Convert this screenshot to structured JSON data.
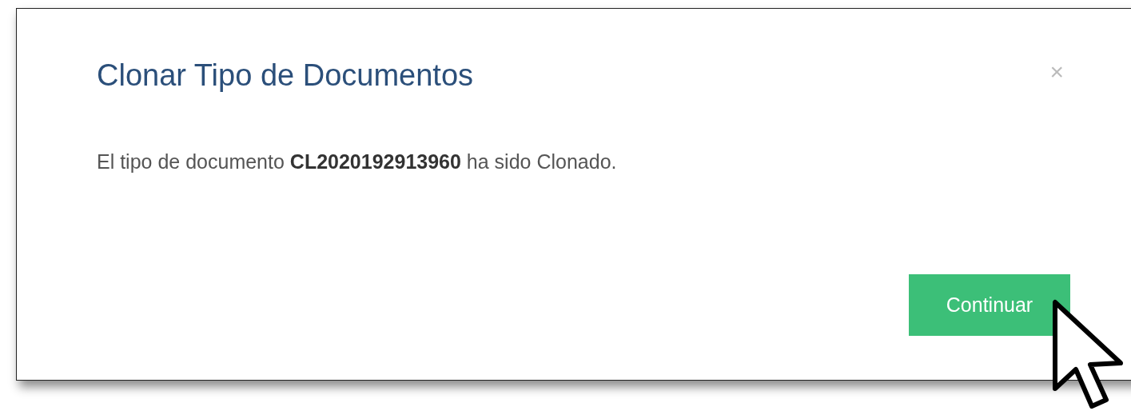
{
  "dialog": {
    "title": "Clonar Tipo de Documentos",
    "close": "×",
    "message": "El tipo de documento **CL2020192913960** ha sido Clonado.",
    "button": "Continuar"
  }
}
